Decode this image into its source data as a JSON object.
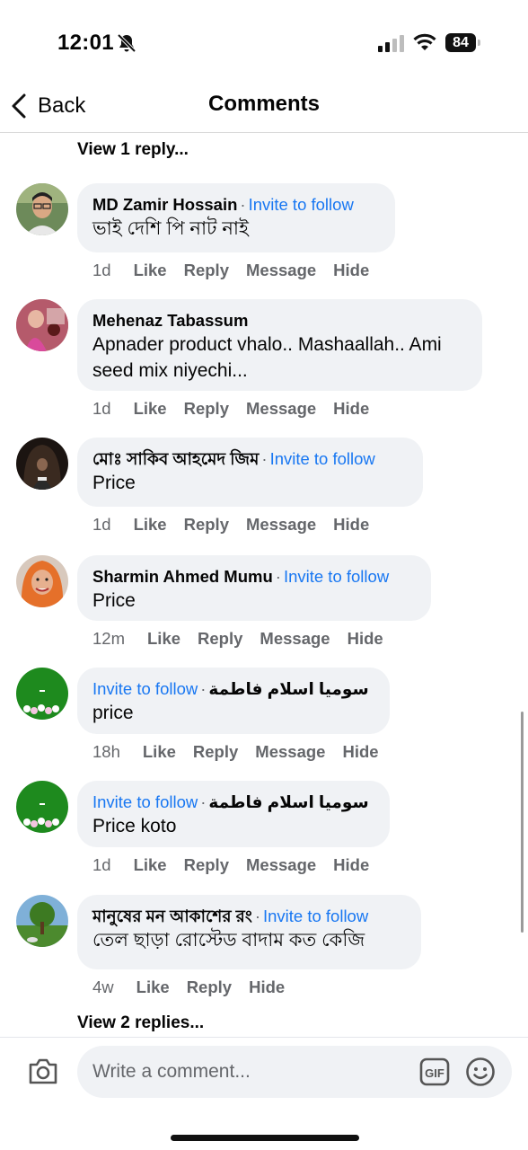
{
  "status_bar": {
    "time": "12:01",
    "battery": "84"
  },
  "nav": {
    "back_label": "Back",
    "title": "Comments"
  },
  "view_replies_top": "View 1 reply...",
  "view_replies_bottom": "View 2 replies...",
  "comments": [
    {
      "author": "MD Zamir Hossain",
      "separator": "·",
      "invite": "Invite to follow",
      "text": "ভাই দেশি পি নাট নাই",
      "age": "1d",
      "actions": [
        "Like",
        "Reply",
        "Message",
        "Hide"
      ]
    },
    {
      "author": "Mehenaz Tabassum",
      "text_line1": "Apnader product vhalo.. Mashaallah.. Ami",
      "text_line2": "seed mix niyechi...",
      "age": "1d",
      "actions": [
        "Like",
        "Reply",
        "Message",
        "Hide"
      ]
    },
    {
      "author": "মোঃ সাকিব আহমেদ জিম",
      "separator": "·",
      "invite": "Invite to follow",
      "text": "Price",
      "age": "1d",
      "actions": [
        "Like",
        "Reply",
        "Message",
        "Hide"
      ]
    },
    {
      "author": "Sharmin Ahmed Mumu",
      "separator": "·",
      "invite": "Invite to follow",
      "text": "Price",
      "age": "12m",
      "actions": [
        "Like",
        "Reply",
        "Message",
        "Hide"
      ]
    },
    {
      "author": "سوميا اسلام فاطمة",
      "separator": "·",
      "invite": "Invite to follow",
      "text": "price",
      "age": "18h",
      "actions": [
        "Like",
        "Reply",
        "Message",
        "Hide"
      ]
    },
    {
      "author": "سوميا اسلام فاطمة",
      "separator": "·",
      "invite": "Invite to follow",
      "text": "Price koto",
      "age": "1d",
      "actions": [
        "Like",
        "Reply",
        "Message",
        "Hide"
      ]
    },
    {
      "author": "মানুষের মন আকাশের রং",
      "separator": "·",
      "invite": "Invite to follow",
      "text": "তেল ছাড়া রোস্টেড বাদাম কত কেজি",
      "age": "4w",
      "actions": [
        "Like",
        "Reply",
        "Hide"
      ]
    }
  ],
  "composer": {
    "placeholder": "Write a comment..."
  },
  "colors": {
    "link_blue": "#1877f2",
    "bubble_bg": "#f0f2f5",
    "meta_gray": "#65676b"
  }
}
